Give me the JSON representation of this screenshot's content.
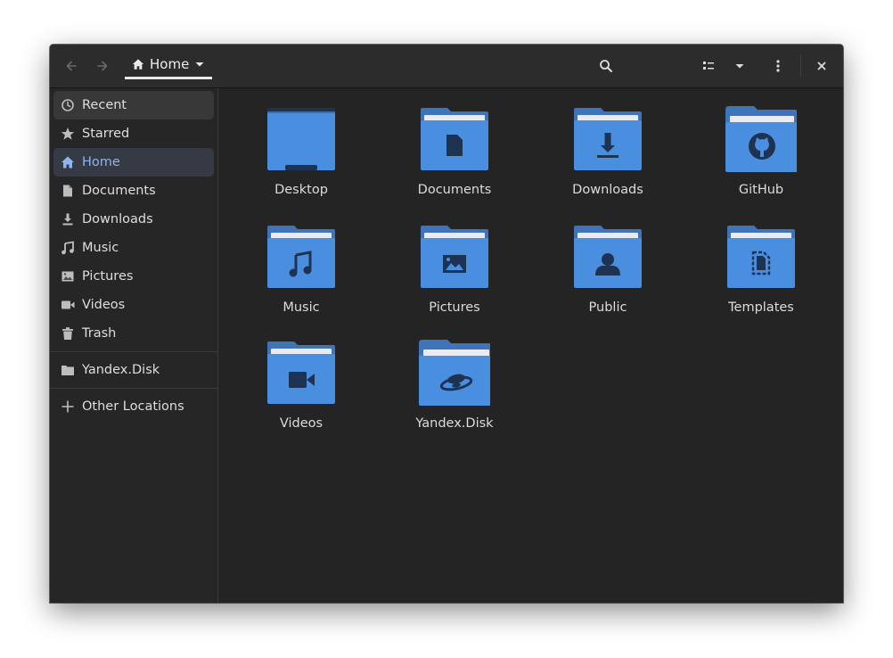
{
  "window": {
    "path_label": "Home"
  },
  "icons": {
    "back": "back-arrow-icon",
    "forward": "forward-arrow-icon",
    "home": "home-icon",
    "dropdown": "chevron-down-icon",
    "search": "search-icon",
    "view": "list-view-icon",
    "view_options": "chevron-down-icon",
    "menu": "kebab-menu-icon",
    "close": "close-icon"
  },
  "sidebar": {
    "items": [
      {
        "label": "Recent",
        "icon": "clock-icon"
      },
      {
        "label": "Starred",
        "icon": "star-icon"
      },
      {
        "label": "Home",
        "icon": "home-icon"
      },
      {
        "label": "Documents",
        "icon": "document-icon"
      },
      {
        "label": "Downloads",
        "icon": "download-icon"
      },
      {
        "label": "Music",
        "icon": "music-note-icon"
      },
      {
        "label": "Pictures",
        "icon": "picture-icon"
      },
      {
        "label": "Videos",
        "icon": "video-camera-icon"
      },
      {
        "label": "Trash",
        "icon": "trash-icon"
      }
    ],
    "mounts": [
      {
        "label": "Yandex.Disk",
        "icon": "folder-icon"
      }
    ],
    "other": {
      "label": "Other Locations",
      "icon": "plus-icon"
    },
    "active": "Home"
  },
  "files": [
    {
      "name": "Desktop",
      "emblem": "desktop-icon"
    },
    {
      "name": "Documents",
      "emblem": "document-icon"
    },
    {
      "name": "Downloads",
      "emblem": "download-icon"
    },
    {
      "name": "GitHub",
      "emblem": "github-icon"
    },
    {
      "name": "Music",
      "emblem": "music-note-icon"
    },
    {
      "name": "Pictures",
      "emblem": "picture-icon"
    },
    {
      "name": "Public",
      "emblem": "person-icon"
    },
    {
      "name": "Templates",
      "emblem": "template-icon"
    },
    {
      "name": "Videos",
      "emblem": "video-camera-icon"
    },
    {
      "name": "Yandex.Disk",
      "emblem": "yandex-disk-icon"
    }
  ],
  "colors": {
    "folder_front": "#4a8ee0",
    "folder_back": "#3f74b8",
    "emblem": "#1e3352",
    "accent": "#8cb4f0"
  }
}
